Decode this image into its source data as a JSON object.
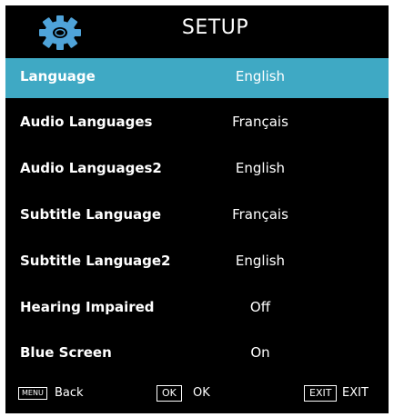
{
  "header": {
    "title": "SETUP",
    "icon": "gear-icon",
    "icon_color": "#4fa3d9"
  },
  "menu": {
    "items": [
      {
        "label": "Language",
        "value": "English",
        "selected": true
      },
      {
        "label": "Audio Languages",
        "value": "Français",
        "selected": false
      },
      {
        "label": "Audio Languages2",
        "value": "English",
        "selected": false
      },
      {
        "label": "Subtitle Language",
        "value": "Français",
        "selected": false
      },
      {
        "label": "Subtitle Language2",
        "value": "English",
        "selected": false
      },
      {
        "label": "Hearing Impaired",
        "value": "Off",
        "selected": false
      },
      {
        "label": "Blue Screen",
        "value": "On",
        "selected": false
      }
    ]
  },
  "footer": {
    "menu_key": "MENU",
    "menu_label": "Back",
    "ok_key": "OK",
    "ok_label": "OK",
    "exit_key": "EXIT",
    "exit_label": "EXIT"
  },
  "colors": {
    "background": "#000000",
    "highlight": "#3fa9c4",
    "text": "#ffffff"
  }
}
